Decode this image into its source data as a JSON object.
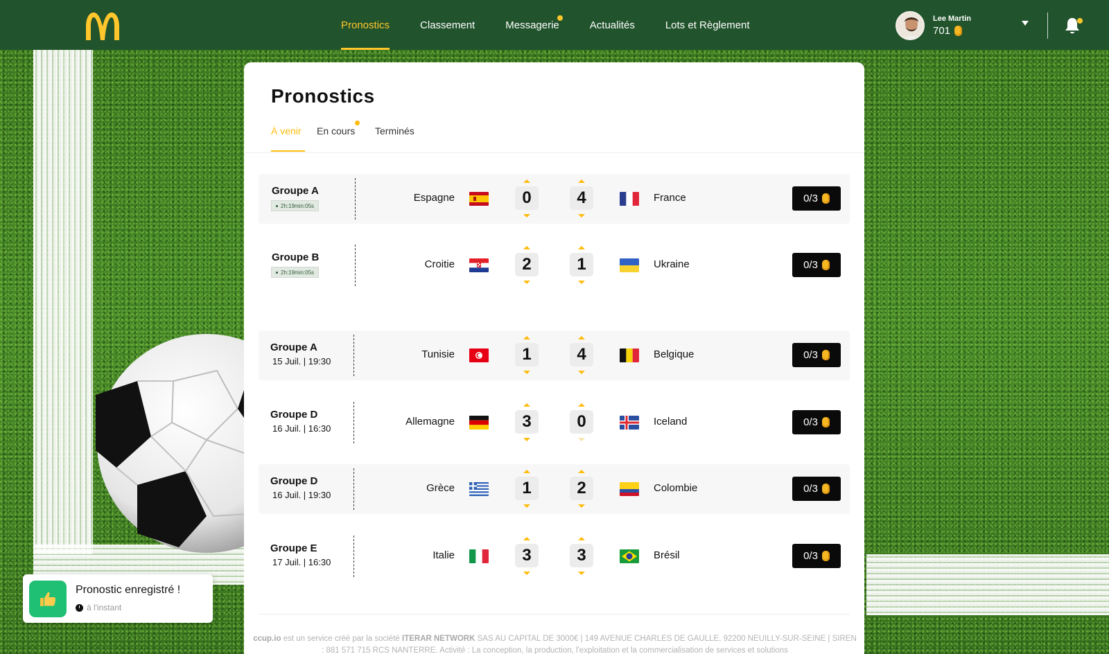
{
  "nav": {
    "items": [
      {
        "label": "Pronostics",
        "active": true,
        "dot": false
      },
      {
        "label": "Classement",
        "active": false,
        "dot": false
      },
      {
        "label": "Messagerie",
        "active": false,
        "dot": true
      },
      {
        "label": "Actualités",
        "active": false,
        "dot": false
      },
      {
        "label": "Lots et Règlement",
        "active": false,
        "dot": false
      }
    ]
  },
  "user": {
    "name": "Lee Martin",
    "points": "701"
  },
  "page": {
    "title": "Pronostics",
    "tabs": [
      {
        "label": "À venir",
        "active": true
      },
      {
        "label": "En cours",
        "active": false,
        "dot": true
      },
      {
        "label": "Terminés",
        "active": false
      }
    ]
  },
  "matches": [
    {
      "group": "Groupe A",
      "timer": "2h:19min:05s",
      "home": "Espagne",
      "home_flag": "spain-flag",
      "home_score": "0",
      "away_score": "4",
      "away": "France",
      "away_flag": "france-flag",
      "points": "0/3"
    },
    {
      "group": "Groupe B",
      "timer": "2h:19min:05s",
      "home": "Croitie",
      "home_flag": "croatia-flag",
      "home_score": "2",
      "away_score": "1",
      "away": "Ukraine",
      "away_flag": "ukraine-flag",
      "points": "0/3"
    },
    {
      "group": "Groupe A",
      "date": "15 Juil. | 19:30",
      "home": "Tunisie",
      "home_flag": "tunisia-flag",
      "home_score": "1",
      "away_score": "4",
      "away": "Belgique",
      "away_flag": "belgium-flag",
      "points": "0/3"
    },
    {
      "group": "Groupe D",
      "date": "16 Juil. | 16:30",
      "home": "Allemagne",
      "home_flag": "germany-flag",
      "home_score": "3",
      "away_score": "0",
      "away": "Iceland",
      "away_flag": "iceland-flag",
      "points": "0/3"
    },
    {
      "group": "Groupe D",
      "date": "16 Juil. | 19:30",
      "home": "Grèce",
      "home_flag": "greece-flag",
      "home_score": "1",
      "away_score": "2",
      "away": "Colombie",
      "away_flag": "colombia-flag",
      "points": "0/3"
    },
    {
      "group": "Groupe E",
      "date": "17 Juil. | 16:30",
      "home": "Italie",
      "home_flag": "italy-flag",
      "home_score": "3",
      "away_score": "3",
      "away": "Brésil",
      "away_flag": "brazil-flag",
      "points": "0/3"
    }
  ],
  "footer": {
    "brand": "ccup.io",
    "text1": "est un service créé par la société",
    "company": "ITERAR NETWORK",
    "text2": "SAS AU CAPITAL DE 3000€ | 149 AVENUE CHARLES DE GAULLE, 92200 NEUILLY-SUR-SEINE | SIREN : 881 571 715 RCS NANTERRE. Activité : La conception, la production, l'exploitation et la commercialisation de services et solutions"
  },
  "toast": {
    "title": "Pronostic enregistré !",
    "time": "à l'instant"
  },
  "colors": {
    "nav_bg": "#21532c",
    "accent": "#ffbc0d",
    "toast_green": "#1fbf74"
  }
}
